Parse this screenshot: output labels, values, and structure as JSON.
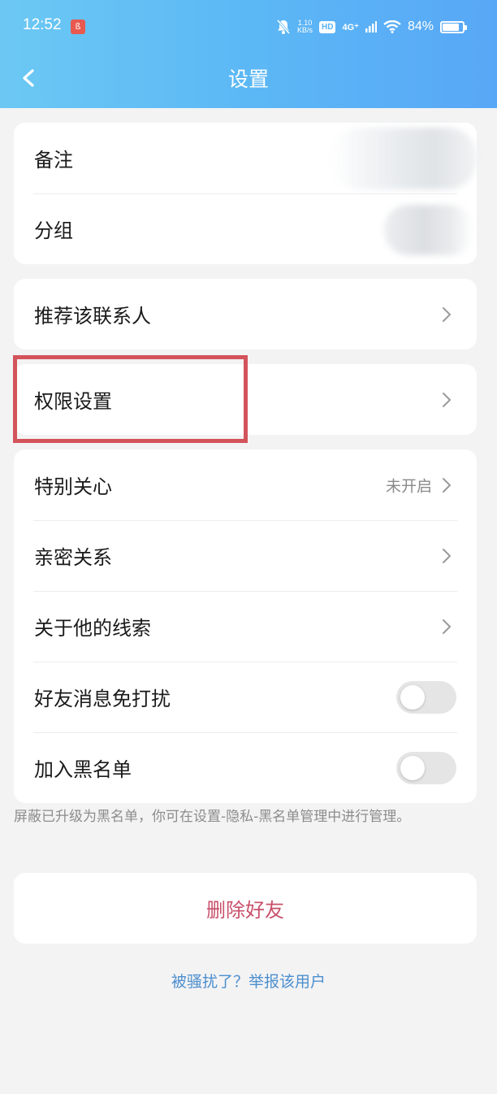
{
  "status_bar": {
    "time": "12:52",
    "app_icon": "app-notification-icon",
    "net_speed_value": "1.10",
    "net_speed_unit": "KB/s",
    "hd_label": "HD",
    "network_label": "4G⁺",
    "battery_text": "84%",
    "battery_level": 0.84
  },
  "nav": {
    "title": "设置",
    "back_icon": "chevron-left-icon"
  },
  "profile_card": {
    "items": [
      {
        "label": "备注"
      },
      {
        "label": "分组"
      }
    ]
  },
  "recommend_card": {
    "label": "推荐该联系人"
  },
  "permission_card": {
    "label": "权限设置"
  },
  "relation_card": {
    "items": [
      {
        "label": "特别关心",
        "value": "未开启"
      },
      {
        "label": "亲密关系"
      },
      {
        "label": "关于他的线索"
      },
      {
        "label": "好友消息免打扰",
        "toggle_on": false
      },
      {
        "label": "加入黑名单",
        "toggle_on": false
      }
    ]
  },
  "blacklist_note": "屏蔽已升级为黑名单，你可在设置-隐私-黑名单管理中进行管理。",
  "delete_button": {
    "label": "删除好友"
  },
  "report_link": "被骚扰了？举报该用户",
  "colors": {
    "header_gradient_start": "#6cc8f3",
    "header_gradient_end": "#58a7f6",
    "highlight": "#d3545b",
    "danger_text": "#c8506a",
    "link": "#4d8fce"
  }
}
